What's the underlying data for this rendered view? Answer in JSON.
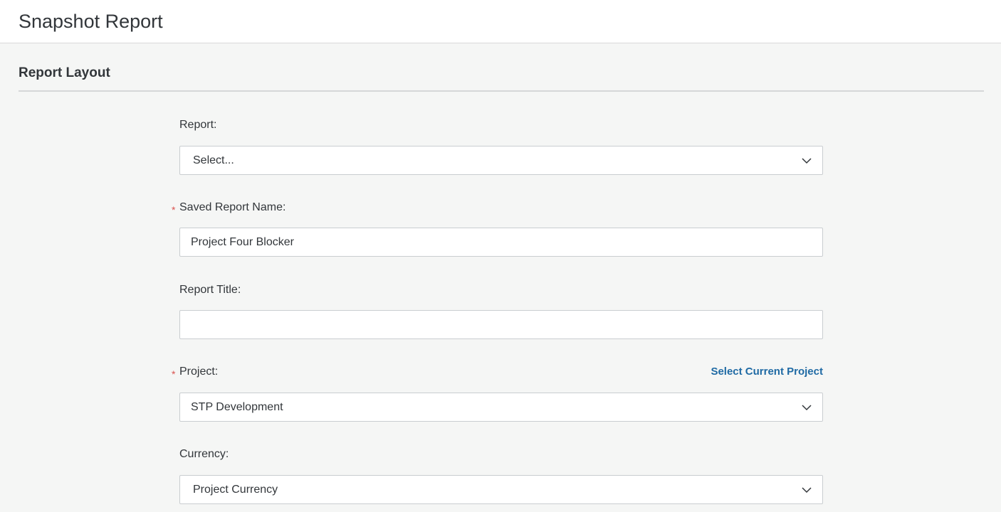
{
  "header": {
    "title": "Snapshot Report"
  },
  "section": {
    "title": "Report Layout"
  },
  "form": {
    "report": {
      "label": "Report:",
      "value": "Select..."
    },
    "saved_report_name": {
      "label": "Saved Report Name:",
      "required_mark": "*",
      "value": "Project Four Blocker"
    },
    "report_title": {
      "label": "Report Title:",
      "value": ""
    },
    "project": {
      "label": "Project:",
      "required_mark": "*",
      "link_label": "Select Current Project",
      "value": "STP Development"
    },
    "currency": {
      "label": "Currency:",
      "value": "Project Currency"
    }
  },
  "icons": {
    "dropdown": "chevron-down-icon"
  },
  "colors": {
    "page_background": "#f5f6f5",
    "header_background": "#ffffff",
    "link": "#1f6aa4",
    "required": "#d9534f",
    "text": "#32363a"
  }
}
